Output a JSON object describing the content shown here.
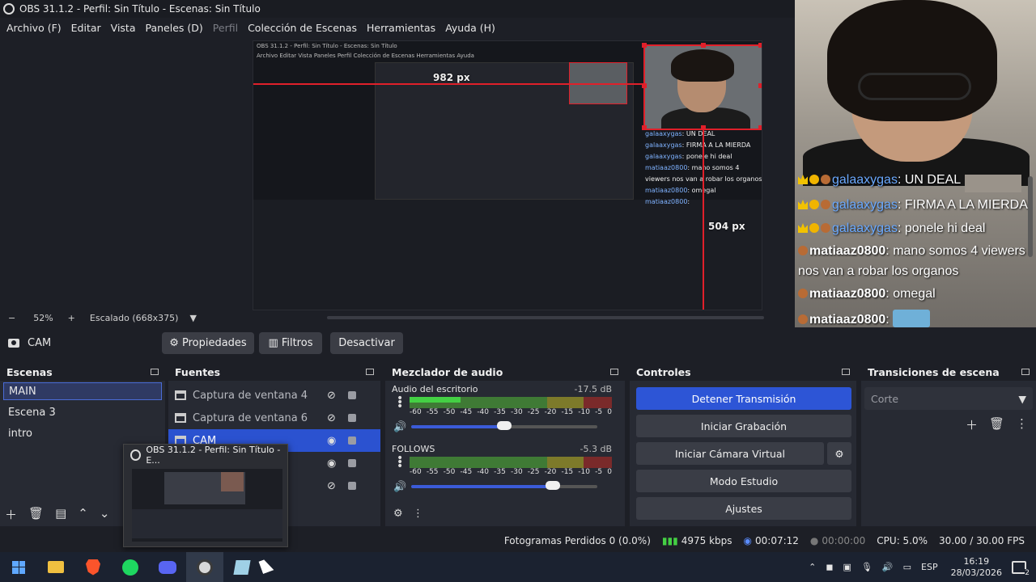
{
  "window": {
    "title": "OBS 31.1.2 - Perfil: Sin Título - Escenas: Sin Título"
  },
  "menu": [
    "Archivo (F)",
    "Editar",
    "Vista",
    "Paneles (D)",
    "Perfil",
    "Colección de Escenas",
    "Herramientas",
    "Ayuda (H)"
  ],
  "preview": {
    "nested_title": "OBS 31.1.2 - Perfil: Sin Título - Escenas: Sin Título",
    "px_label_1": "982 px",
    "px_label_2": "504 px",
    "mini_chat": [
      {
        "user": "galaaxygas",
        "text": ": UN DEAL"
      },
      {
        "user": "galaaxygas",
        "text": ": FIRMA A LA MIERDA"
      },
      {
        "user": "galaaxygas",
        "text": ": ponele hi deal"
      },
      {
        "user": "matiaaz0800",
        "text": ": mano somos 4 viewers nos van a robar los organos"
      },
      {
        "user": "matiaaz0800",
        "text": ": omegal"
      },
      {
        "user": "matiaaz0800",
        "text": ":"
      }
    ],
    "zoom_minus": "−",
    "zoom": "52%",
    "zoom_plus": "+",
    "scale": "Escalado (668x375)"
  },
  "chat": [
    {
      "user": "galaaxygas",
      "text": ": UN DEAL"
    },
    {
      "user": "galaaxygas",
      "text": ": FIRMA A LA MIERDA"
    },
    {
      "user": "galaaxygas",
      "text": ": ponele hi deal"
    },
    {
      "user": "matiaaz0800",
      "text": ": mano somos 4 viewers"
    },
    {
      "user": "",
      "text": "nos van a robar los organos"
    },
    {
      "user": "matiaaz0800",
      "text": ": omegal"
    },
    {
      "user": "matiaaz0800",
      "text": ":"
    }
  ],
  "source_toolbar": {
    "source_name": "CAM",
    "properties": "Propiedades",
    "filters": "Filtros",
    "deactivate": "Desactivar"
  },
  "scenes": {
    "title": "Escenas",
    "items": [
      "MAIN",
      "Escena 3",
      "intro"
    ]
  },
  "sources": {
    "title": "Fuentes",
    "items": [
      "Captura de ventana 4",
      "Captura de ventana 6",
      "CAM"
    ]
  },
  "mixer": {
    "title": "Mezclador de audio",
    "channels": [
      {
        "name": "Audio del escritorio",
        "db": "-17.5 dB",
        "level": 0.25,
        "volume": 0.5
      },
      {
        "name": "FOLLOWS",
        "db": "-5.3 dB",
        "level": 0.0,
        "volume": 0.76
      }
    ],
    "ticks": [
      "-60",
      "-55",
      "-50",
      "-45",
      "-40",
      "-35",
      "-30",
      "-25",
      "-20",
      "-15",
      "-10",
      "-5",
      "0"
    ]
  },
  "controls": {
    "title": "Controles",
    "stop_stream": "Detener Transmisión",
    "start_recording": "Iniciar Grabación",
    "virtual_cam": "Iniciar Cámara Virtual",
    "studio_mode": "Modo Estudio",
    "settings": "Ajustes"
  },
  "transitions": {
    "title": "Transiciones de escena",
    "selected": "Corte"
  },
  "status": {
    "dropped": "Fotogramas Perdidos 0 (0.0%)",
    "bitrate": "4975 kbps",
    "stream_time": "00:07:12",
    "rec_time": "00:00:00",
    "cpu": "CPU: 5.0%",
    "fps": "30.00 / 30.00 FPS"
  },
  "thumbnail": {
    "title": "OBS 31.1.2 - Perfil: Sin Título - E..."
  },
  "taskbar": {
    "lang": "ESP",
    "time": "16:19",
    "date": "28/03/2026",
    "notifications": "2"
  },
  "colors": {
    "accent": "#2d55d6",
    "alert": "#e0202a"
  }
}
